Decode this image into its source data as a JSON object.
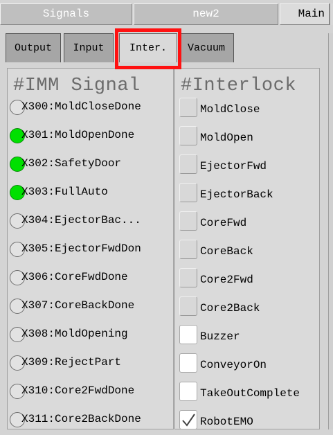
{
  "top_tabs": [
    "Signals",
    "new2",
    "Main"
  ],
  "sub_tabs": [
    "Output",
    "Input",
    "Inter.",
    "Vacuum"
  ],
  "imm": {
    "title": "#IMM Signal",
    "signals": [
      {
        "label": "X300:MoldCloseDone",
        "on": false
      },
      {
        "label": "X301:MoldOpenDone",
        "on": true
      },
      {
        "label": "X302:SafetyDoor",
        "on": true
      },
      {
        "label": "X303:FullAuto",
        "on": true
      },
      {
        "label": "X304:EjectorBac...",
        "on": false
      },
      {
        "label": "X305:EjectorFwdDon",
        "on": false
      },
      {
        "label": "X306:CoreFwdDone",
        "on": false
      },
      {
        "label": "X307:CoreBackDone",
        "on": false
      },
      {
        "label": "X308:MoldOpening",
        "on": false
      },
      {
        "label": "X309:RejectPart",
        "on": false
      },
      {
        "label": "X310:Core2FwdDone",
        "on": false
      },
      {
        "label": "X311:Core2BackDone",
        "on": false
      }
    ]
  },
  "interlock": {
    "title": "#Interlock",
    "items": [
      {
        "label": "MoldClose",
        "checked": false
      },
      {
        "label": "MoldOpen",
        "checked": false
      },
      {
        "label": "EjectorFwd",
        "checked": false
      },
      {
        "label": "EjectorBack",
        "checked": false
      },
      {
        "label": "CoreFwd",
        "checked": false
      },
      {
        "label": "CoreBack",
        "checked": false
      },
      {
        "label": "Core2Fwd",
        "checked": false
      },
      {
        "label": "Core2Back",
        "checked": false
      },
      {
        "label": "Buzzer",
        "checked": false
      },
      {
        "label": "ConveyorOn",
        "checked": false
      },
      {
        "label": "TakeOutComplete",
        "checked": false
      },
      {
        "label": "RobotEMO",
        "checked": true
      }
    ]
  },
  "colors": {
    "led_on": "#00e000",
    "highlight": "#ff1111"
  }
}
